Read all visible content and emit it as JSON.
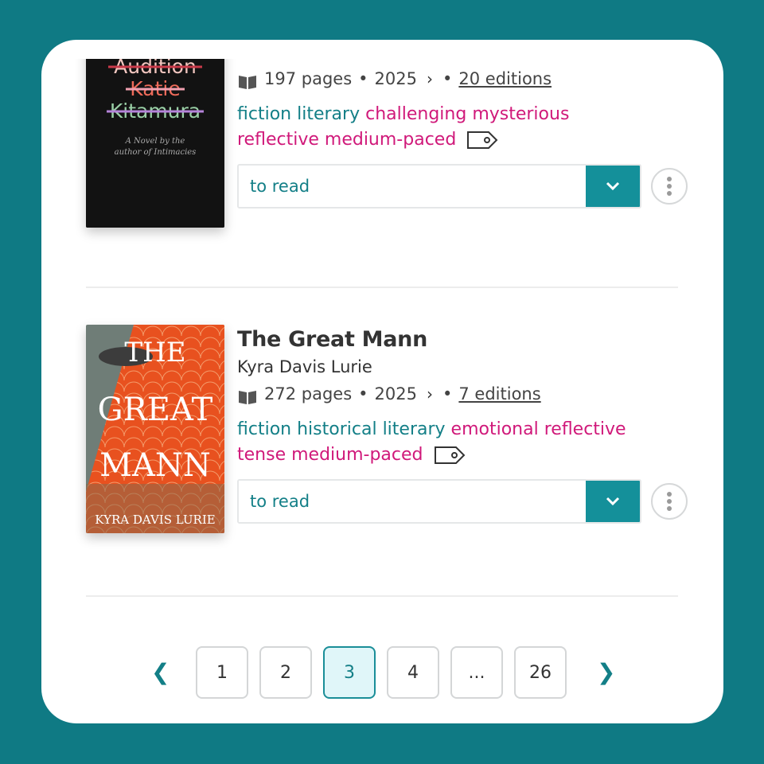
{
  "books": [
    {
      "title": "Audition",
      "author": "Katie Kitamura",
      "pages": "197 pages",
      "year": "2025",
      "editions": "20 editions",
      "genres": [
        "fiction",
        "literary"
      ],
      "moods_line1": [
        "challenging",
        "mysterious"
      ],
      "moods_line2": [
        "reflective",
        "medium-paced"
      ],
      "shelf": "to read",
      "cover": {
        "title": "Audition",
        "author_first": "Katie",
        "author_last": "Kitamura",
        "tagline_1": "A Novel by the",
        "tagline_2": "author of Intimacies",
        "bg": "#121212"
      }
    },
    {
      "title": "The Great Mann",
      "author": "Kyra Davis Lurie",
      "pages": "272 pages",
      "year": "2025",
      "editions": "7 editions",
      "genres": [
        "fiction",
        "historical",
        "literary"
      ],
      "moods_line1": [
        "emotional",
        "reflective"
      ],
      "moods_line2": [
        "tense",
        "medium-paced"
      ],
      "shelf": "to read",
      "cover": {
        "line1": "THE",
        "line2": "GREAT",
        "line3": "MANN",
        "author": "KYRA DAVIS LURIE",
        "bg": "#e8511f"
      }
    }
  ],
  "separator": "•",
  "pagination": {
    "prev": "❮",
    "next": "❯",
    "pages": [
      "1",
      "2",
      "3",
      "4",
      "...",
      "26"
    ],
    "current": "3"
  },
  "colors": {
    "background": "#0f7a84",
    "genre": "#137f87",
    "mood": "#d0197a",
    "accent": "#14909a"
  }
}
